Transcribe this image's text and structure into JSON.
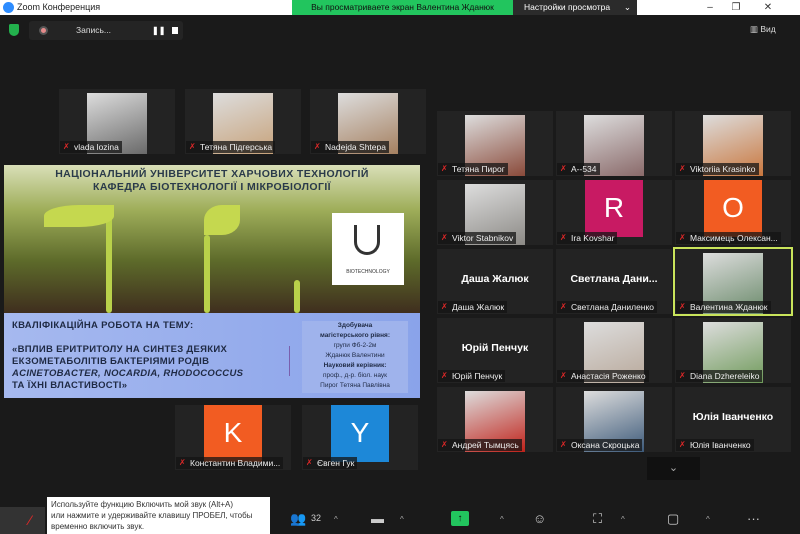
{
  "window": {
    "title": "Zoom Конференция",
    "minimize": "–",
    "restore": "❐",
    "close": "✕"
  },
  "banner": {
    "text": "Вы просматриваете экран Валентина Жданюк",
    "view_settings": "Настройки просмотра",
    "chevron": "⌄"
  },
  "recording": {
    "label": "Запись...",
    "pause": "❚❚"
  },
  "view_button": "▥ Вид",
  "colors": {
    "accent_green": "#22c55e",
    "mute_red": "#e02828",
    "active_speaker": "#c9e45b"
  },
  "left_top_participants": [
    {
      "name": "vlada lozina",
      "type": "photo",
      "color": "#6a6a6a"
    },
    {
      "name": "Тетяна Підгерська",
      "type": "photo",
      "color": "#c7a27a"
    },
    {
      "name": "Nadejda Shtepa",
      "type": "photo",
      "color": "#a58060"
    }
  ],
  "left_bottom_participants": [
    {
      "name": "Константин Владими...",
      "type": "avatar",
      "letter": "K",
      "color": "#f25c22"
    },
    {
      "name": "Євген Гук",
      "type": "avatar",
      "letter": "Y",
      "color": "#1d88d8"
    }
  ],
  "grid_participants": [
    {
      "name": "Тетяна Пирог",
      "type": "photo",
      "color": "#8a4a3a"
    },
    {
      "name": "A--534",
      "type": "photo",
      "color": "#8a6a6a"
    },
    {
      "name": "Viktoriia Krasinko",
      "type": "photo",
      "color": "#c9773e"
    },
    {
      "name": "Viktor Stabnikov",
      "type": "photo",
      "color": "#8c8a86"
    },
    {
      "name": "Ira Kovshar",
      "type": "avatar",
      "letter": "R",
      "color": "#c81a63"
    },
    {
      "name": "Максимець Олексан...",
      "type": "avatar",
      "letter": "O",
      "color": "#f25c22"
    },
    {
      "name": "Даша Жалюк",
      "type": "name",
      "big": "Даша Жалюк"
    },
    {
      "name": "Светлана Даниленко",
      "type": "name",
      "big": "Светлана  Дани..."
    },
    {
      "name": "Валентина Жданюк",
      "type": "photo",
      "color": "#6a8a6a",
      "active": true
    },
    {
      "name": "Юрій Пенчук",
      "type": "name",
      "big": "Юрій Пенчук"
    },
    {
      "name": "Анастасія Роженко",
      "type": "photo",
      "color": "#b8a89a"
    },
    {
      "name": "Diana Dzhereleiko",
      "type": "photo",
      "color": "#6f9a5a"
    },
    {
      "name": "Андрей Тымцясь",
      "type": "photo",
      "color": "#c0221a"
    },
    {
      "name": "Оксана Скроцька",
      "type": "photo",
      "color": "#3d5a7a"
    },
    {
      "name": "Юлія Іванченко",
      "type": "name",
      "big": "Юлія Іванченко"
    }
  ],
  "slide": {
    "header1": "НАЦІОНАЛЬНИЙ УНІВЕРСИТЕТ ХАРЧОВИХ ТЕХНОЛОГІЙ",
    "header2": "КАФЕДРА БІОТЕХНОЛОГІЇ І МІКРОБІОЛОГІЇ",
    "logo_text": "BIOTECHNOLOGY",
    "topic_label": "КВАЛІФІКАЦІЙНА РОБОТА НА ТЕМУ:",
    "title_lines": [
      "«ВПЛИВ ЕРИТРИТОЛУ НА СИНТЕЗ ДЕЯКИХ",
      "ЕКЗОМЕТАБОЛІТІВ БАКТЕРІЯМИ РОДІВ",
      "ACINETOBACTER, NOCARDIA, RHODOCOCCUS",
      "ТА ЇХНІ ВЛАСТИВОСТІ»"
    ],
    "side": [
      "Здобувача",
      "магістерського рівня:",
      "групи Фб-2-2м",
      "Жданюк Валентини",
      "Науковий керівник:",
      "проф., д-р. біол. наук",
      "Пирог Тетяна Павлівна"
    ]
  },
  "scroll_down": "⌄",
  "toolbar": {
    "tooltip": [
      "Используйте функцию Включить мой звук (Alt+A)",
      "или нажмите и удерживайте клавишу ПРОБЕЛ, чтобы",
      "временно включить звук."
    ],
    "participants_count": "32",
    "caret": "^",
    "more": "···"
  }
}
